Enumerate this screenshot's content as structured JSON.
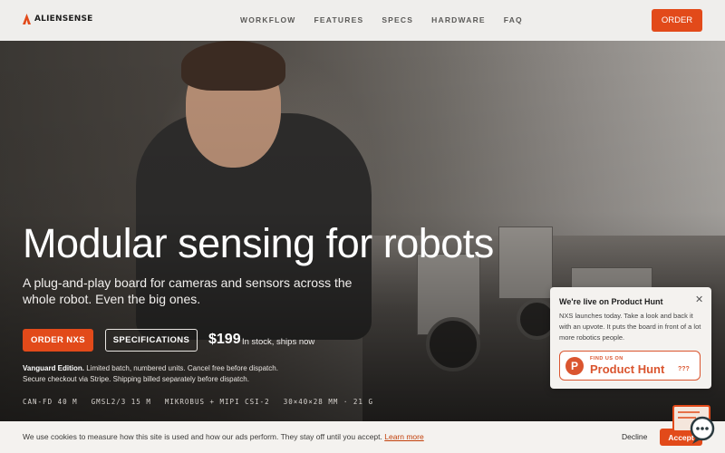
{
  "brand": {
    "name": "ALIENSENSE",
    "accent": "#e24a1a"
  },
  "nav": {
    "links": [
      "WORKFLOW",
      "FEATURES",
      "SPECS",
      "HARDWARE",
      "FAQ"
    ],
    "order_label": "ORDER"
  },
  "hero": {
    "title": "Modular sensing for robots",
    "subtitle": "A plug-and-play board for cameras and sensors across the whole robot. Even the big ones.",
    "primary_label": "ORDER NXS",
    "secondary_label": "SPECIFICATIONS",
    "price": "$199",
    "stock": "In stock, ships now",
    "edition_bold": "Vanguard Edition.",
    "edition_line1": " Limited batch, numbered units. Cancel free before dispatch.",
    "edition_line2": "Secure checkout via Stripe. Shipping billed separately before dispatch.",
    "specs": [
      "CAN-FD 40 M",
      "GMSL2/3 15 M",
      "MIKROBUS + MIPI CSI-2",
      "30×40×28 MM · 21 G"
    ]
  },
  "producthunt": {
    "title": "We're live on Product Hunt",
    "close_icon": "close-icon",
    "body": "NXS launches today. Take a look and back it with an upvote. It puts the board in front of a lot more robotics people.",
    "badge_find": "FIND US ON",
    "badge_name": "Product Hunt",
    "badge_count": "???",
    "badge_letter": "P",
    "color": "#da552f"
  },
  "cookie": {
    "text": "We use cookies to measure how this site is used and how our ads perform. They stay off until you accept.",
    "link": "Learn more",
    "decline": "Decline",
    "accept": "Accept"
  },
  "chat_icon": "chat-support-icon"
}
